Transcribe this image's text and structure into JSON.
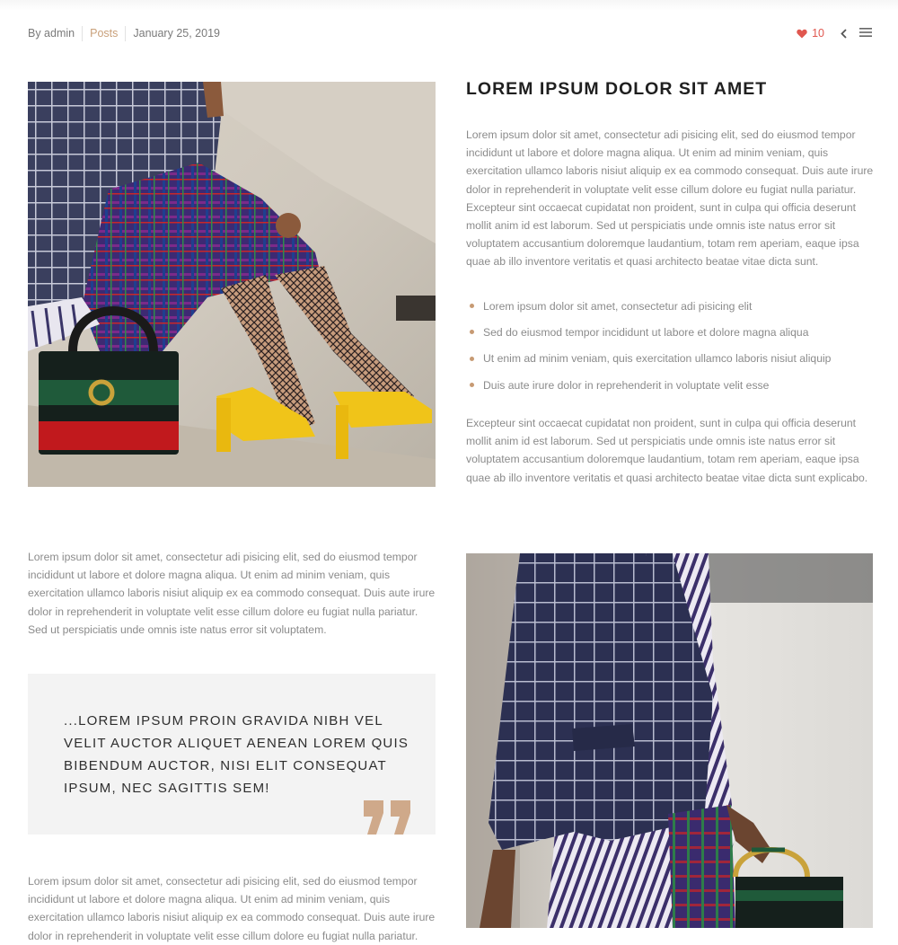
{
  "meta": {
    "author": "By admin",
    "category": "Posts",
    "date": "January 25, 2019"
  },
  "actions": {
    "likes": "10"
  },
  "colors": {
    "accent": "#c79a73",
    "like": "#e0574f",
    "title": "#1f1f1f",
    "body_text": "#8b8b8b",
    "quote_bg": "#f3f3f3"
  },
  "icons": {
    "like": "heart-icon",
    "back": "chevron-left-icon",
    "menu": "hamburger-menu-icon",
    "quote": "quote-mark-icon"
  },
  "post": {
    "title": "LOREM IPSUM DOLOR SIT AMET",
    "para1": "Lorem ipsum dolor sit amet, consectetur adi pisicing elit, sed do eiusmod tempor incididunt ut labore et dolore magna aliqua. Ut enim ad minim veniam, quis exercitation ullamco laboris nisiut aliquip ex ea commodo consequat. Duis aute irure dolor in reprehenderit in voluptate velit esse cillum dolore eu fugiat nulla pariatur. Excepteur sint occaecat cupidatat non proident, sunt in culpa qui officia deserunt mollit anim id est laborum. Sed ut perspiciatis unde omnis iste natus error sit voluptatem accusantium doloremque laudantium, totam rem aperiam, eaque ipsa quae ab illo inventore veritatis et quasi architecto beatae vitae dicta sunt.",
    "bullets": [
      "Lorem ipsum dolor sit amet, consectetur adi pisicing elit",
      "Sed do eiusmod tempor incididunt ut labore et dolore magna aliqua",
      "Ut enim ad minim veniam, quis exercitation ullamco laboris nisiut aliquip",
      "Duis aute irure dolor in reprehenderit in voluptate velit esse"
    ],
    "para2": "Excepteur sint occaecat cupidatat non proident, sunt in culpa qui officia deserunt mollit anim id est laborum. Sed ut perspiciatis unde omnis iste natus error sit voluptatem accusantium doloremque laudantium, totam rem aperiam, eaque ipsa quae ab illo inventore veritatis et quasi architecto beatae vitae dicta sunt explicabo.",
    "para3": "Lorem ipsum dolor sit amet, consectetur adi pisicing elit, sed do eiusmod tempor incididunt ut labore et dolore magna aliqua. Ut enim ad minim veniam, quis exercitation ullamco laboris nisiut aliquip ex ea commodo consequat. Duis aute irure dolor in reprehenderit in voluptate velit esse cillum dolore eu fugiat nulla pariatur. Sed ut perspiciatis unde omnis iste natus error sit voluptatem.",
    "quote": "...LOREM IPSUM PROIN GRAVIDA NIBH VEL VELIT AUCTOR ALIQUET AENEAN LOREM QUIS BIBENDUM AUCTOR, NISI ELIT CONSEQUAT IPSUM, NEC SAGITTIS SEM!",
    "para4": "Lorem ipsum dolor sit amet, consectetur adi pisicing elit, sed do eiusmod tempor incididunt ut labore et dolore magna aliqua. Ut enim ad minim veniam, quis exercitation ullamco laboris nisiut aliquip ex ea commodo consequat. Duis aute irure dolor in reprehenderit in voluptate velit esse cillum dolore eu fugiat nulla pariatur."
  }
}
